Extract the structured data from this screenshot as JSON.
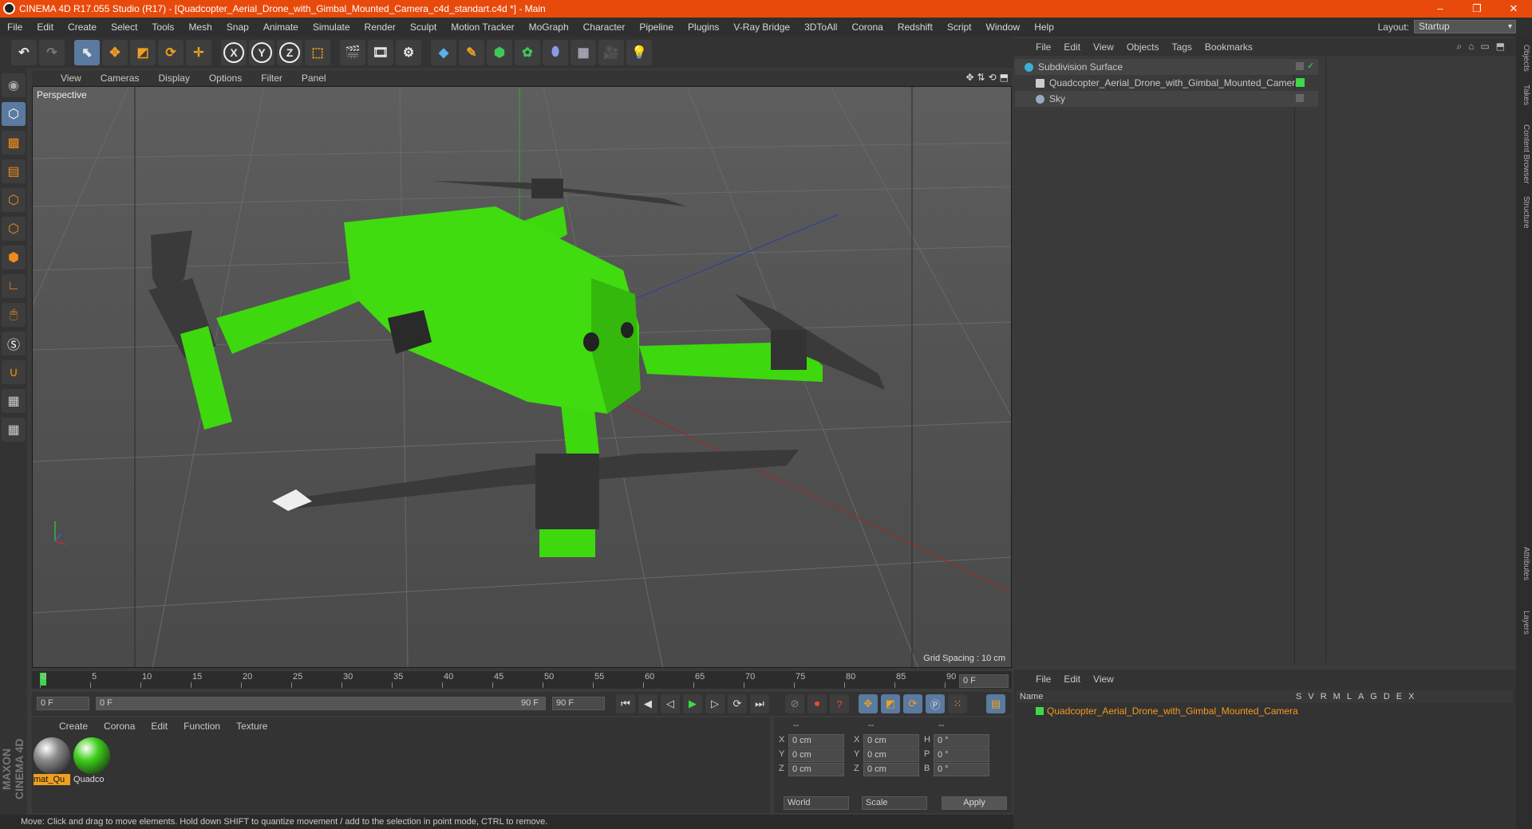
{
  "window": {
    "title": "CINEMA 4D R17.055 Studio (R17) - [Quadcopter_Aerial_Drone_with_Gimbal_Mounted_Camera_c4d_standart.c4d *] - Main",
    "minimize": "–",
    "restore": "❐",
    "close": "✕"
  },
  "menubar": {
    "items": [
      "File",
      "Edit",
      "Create",
      "Select",
      "Tools",
      "Mesh",
      "Snap",
      "Animate",
      "Simulate",
      "Render",
      "Sculpt",
      "Motion Tracker",
      "MoGraph",
      "Character",
      "Pipeline",
      "Plugins",
      "V-Ray Bridge",
      "3DToAll",
      "Corona",
      "Redshift",
      "Script",
      "Window",
      "Help"
    ],
    "layout_label": "Layout:",
    "layout_value": "Startup"
  },
  "toolbar": {
    "axis_labels": [
      "X",
      "Y",
      "Z"
    ]
  },
  "viewport": {
    "menu": [
      "View",
      "Cameras",
      "Display",
      "Options",
      "Filter",
      "Panel"
    ],
    "label": "Perspective",
    "grid_spacing": "Grid Spacing : 10 cm",
    "accent_colors": {
      "drone": "#3fdc0c",
      "carbon": "#3a3a3a",
      "x_axis": "#b02020",
      "y_axis": "#1f9a1f",
      "z_axis": "#2a3f9a"
    }
  },
  "timeline": {
    "ticks": [
      "0",
      "5",
      "10",
      "15",
      "20",
      "25",
      "30",
      "35",
      "40",
      "45",
      "50",
      "55",
      "60",
      "65",
      "70",
      "75",
      "80",
      "85",
      "90"
    ],
    "current_frame": "0 F"
  },
  "playback": {
    "start": "0 F",
    "slider_start": "0 F",
    "slider_end": "90 F",
    "end": "90 F"
  },
  "material_manager": {
    "menu": [
      "Create",
      "Corona",
      "Edit",
      "Function",
      "Texture"
    ],
    "materials": [
      {
        "label": "mat_Qu",
        "color": "#8a8a8a"
      },
      {
        "label": "Quadco",
        "color": "#3fcf1c"
      }
    ]
  },
  "coordinates": {
    "headers": [
      "--",
      "--",
      "--"
    ],
    "rows": [
      {
        "a": "X",
        "av": "0 cm",
        "b": "X",
        "bv": "0 cm",
        "c": "H",
        "cv": "0 °"
      },
      {
        "a": "Y",
        "av": "0 cm",
        "b": "Y",
        "bv": "0 cm",
        "c": "P",
        "cv": "0 °"
      },
      {
        "a": "Z",
        "av": "0 cm",
        "b": "Z",
        "bv": "0 cm",
        "c": "B",
        "cv": "0 °"
      }
    ],
    "world": "World",
    "scale": "Scale",
    "apply": "Apply"
  },
  "object_manager": {
    "menu": [
      "File",
      "Edit",
      "View",
      "Objects",
      "Tags",
      "Bookmarks"
    ],
    "objects": [
      {
        "name": "Subdivision Surface",
        "icon_color": "#38b0d8"
      },
      {
        "name": "Quadcopter_Aerial_Drone_with_Gimbal_Mounted_Camera",
        "icon_color": "#cccccc"
      },
      {
        "name": "Sky",
        "icon_color": "#9aa8c0"
      }
    ]
  },
  "layer_manager": {
    "menu": [
      "File",
      "Edit",
      "View"
    ],
    "header_name": "Name",
    "header_flags": [
      "S",
      "V",
      "R",
      "M",
      "L",
      "A",
      "G",
      "D",
      "E",
      "X"
    ],
    "layer_name": "Quadcopter_Aerial_Drone_with_Gimbal_Mounted_Camera"
  },
  "right_tabs": [
    "Objects",
    "Takes",
    "Content Browser",
    "Structure",
    "Attributes",
    "Layers"
  ],
  "status": "Move: Click and drag to move elements. Hold down SHIFT to quantize movement / add to the selection in point mode, CTRL to remove."
}
